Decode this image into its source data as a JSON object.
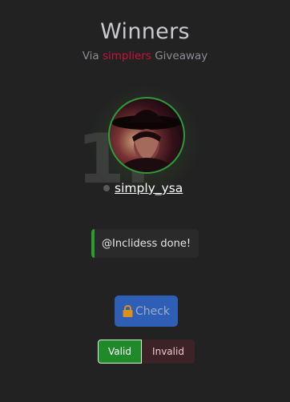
{
  "header": {
    "title": "Winners",
    "subtitle_prefix": "Via",
    "subtitle_brand": "simpliers",
    "subtitle_suffix": "Giveaway"
  },
  "winner": {
    "rank": "1.",
    "username": "simply_ysa",
    "comment": "@Inclidess done!",
    "avatar_ring_color": "#2e9a3a"
  },
  "actions": {
    "check_label": "Check",
    "valid_label": "Valid",
    "invalid_label": "Invalid"
  },
  "colors": {
    "brand": "#c8113c",
    "check_button": "#2e5fb5",
    "valid": "#1f8a2a",
    "invalid": "#3b2328",
    "comment_accent": "#2c9a35"
  },
  "icons": {
    "check_button_icon": "lock-icon"
  }
}
